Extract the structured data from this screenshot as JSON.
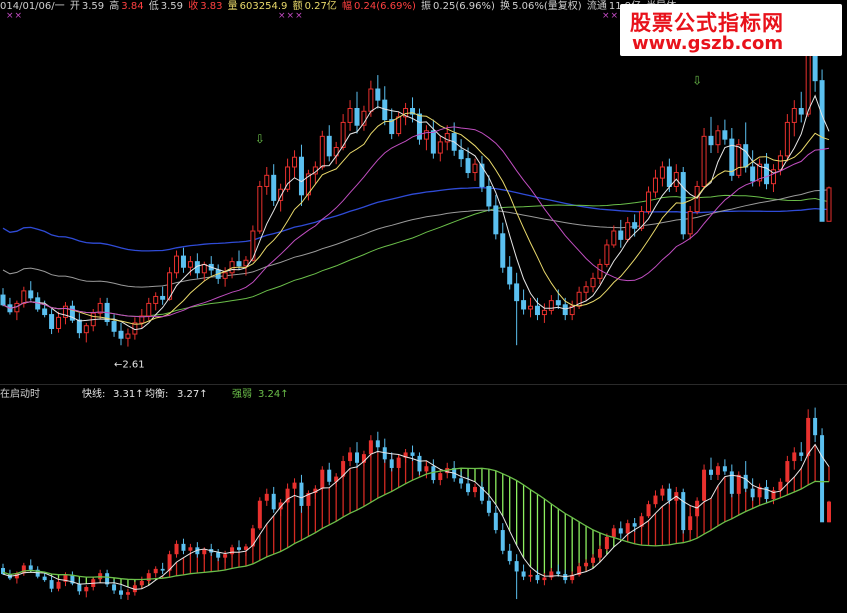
{
  "header": {
    "date": "014/01/06/一",
    "open_label": "开",
    "open": "3.59",
    "high_label": "高",
    "high": "3.84",
    "low_label": "低",
    "low": "3.59",
    "close_label": "收",
    "close": "3.83",
    "volume_label": "量",
    "volume": "603254.9",
    "amount_label": "额",
    "amount": "0.27亿",
    "change_label": "幅",
    "change": "0.24(6.69%)",
    "swing_label": "振",
    "swing": "0.25(6.96%)",
    "turnover_label": "换",
    "turnover": "5.06%(量复权)",
    "float_label": "流通",
    "float": "11.9亿",
    "period": "半导体",
    "marks": [
      "××",
      "×××",
      "××"
    ]
  },
  "watermark": {
    "line1": "股票公式指标网",
    "line2": "www.gszb.com"
  },
  "indicator": {
    "title": "在启动时",
    "fast_label": "快线:",
    "fast": "3.31↑",
    "balance_label": "均衡:",
    "balance": "3.27↑",
    "strength_label": "强弱",
    "strength": "3.24↑"
  },
  "colors": {
    "up": "#e8312e",
    "down": "#5bc0f0",
    "ma_white": "#e6e6e6",
    "ma_yellow": "#e9d96b",
    "ma_purple": "#c04ec0",
    "ma_green": "#6bbf4a",
    "ma_blue": "#2f4bd6",
    "ma_gray": "#9a9a9a",
    "osc_red": "#d32a22",
    "osc_green": "#8df060"
  },
  "chart_data": [
    {
      "type": "candlestick",
      "low_marker": "←2.61",
      "signal_marks": [
        "⇩",
        "⇩"
      ],
      "candles": [
        [
          3.06,
          3.11,
          2.98,
          2.99
        ],
        [
          2.99,
          3.04,
          2.92,
          2.94
        ],
        [
          2.94,
          3.02,
          2.88,
          3.0
        ],
        [
          3.0,
          3.12,
          2.97,
          3.09
        ],
        [
          3.09,
          3.16,
          3.02,
          3.04
        ],
        [
          3.04,
          3.08,
          2.94,
          2.96
        ],
        [
          2.96,
          3.02,
          2.9,
          2.92
        ],
        [
          2.92,
          2.96,
          2.78,
          2.82
        ],
        [
          2.82,
          2.94,
          2.79,
          2.9
        ],
        [
          2.9,
          3.01,
          2.85,
          2.98
        ],
        [
          2.98,
          3.02,
          2.86,
          2.88
        ],
        [
          2.88,
          2.93,
          2.75,
          2.79
        ],
        [
          2.79,
          2.86,
          2.72,
          2.84
        ],
        [
          2.84,
          2.96,
          2.8,
          2.93
        ],
        [
          2.93,
          3.04,
          2.89,
          3.0
        ],
        [
          3.0,
          3.04,
          2.84,
          2.87
        ],
        [
          2.87,
          2.92,
          2.76,
          2.8
        ],
        [
          2.8,
          2.86,
          2.7,
          2.75
        ],
        [
          2.75,
          2.82,
          2.69,
          2.78
        ],
        [
          2.78,
          2.9,
          2.74,
          2.86
        ],
        [
          2.86,
          2.96,
          2.82,
          2.91
        ],
        [
          2.91,
          3.04,
          2.88,
          3.0
        ],
        [
          3.0,
          3.08,
          2.95,
          3.05
        ],
        [
          3.05,
          3.12,
          2.99,
          3.03
        ],
        [
          3.03,
          3.26,
          3.02,
          3.22
        ],
        [
          3.22,
          3.38,
          3.18,
          3.34
        ],
        [
          3.34,
          3.4,
          3.22,
          3.26
        ],
        [
          3.26,
          3.34,
          3.2,
          3.3
        ],
        [
          3.3,
          3.36,
          3.18,
          3.22
        ],
        [
          3.22,
          3.3,
          3.16,
          3.28
        ],
        [
          3.28,
          3.34,
          3.2,
          3.24
        ],
        [
          3.24,
          3.28,
          3.14,
          3.18
        ],
        [
          3.18,
          3.26,
          3.12,
          3.22
        ],
        [
          3.22,
          3.33,
          3.18,
          3.3
        ],
        [
          3.3,
          3.38,
          3.24,
          3.27
        ],
        [
          3.27,
          3.34,
          3.2,
          3.31
        ],
        [
          3.31,
          3.56,
          3.3,
          3.52
        ],
        [
          3.52,
          3.88,
          3.5,
          3.84
        ],
        [
          3.84,
          3.98,
          3.78,
          3.92
        ],
        [
          3.92,
          4.0,
          3.7,
          3.74
        ],
        [
          3.74,
          3.86,
          3.66,
          3.82
        ],
        [
          3.82,
          4.04,
          3.8,
          3.98
        ],
        [
          3.98,
          4.1,
          3.9,
          4.05
        ],
        [
          4.05,
          4.14,
          3.7,
          3.78
        ],
        [
          3.78,
          3.96,
          3.74,
          3.93
        ],
        [
          3.93,
          4.02,
          3.86,
          3.98
        ],
        [
          3.98,
          4.24,
          3.96,
          4.2
        ],
        [
          4.2,
          4.28,
          4.02,
          4.06
        ],
        [
          4.06,
          4.16,
          4.0,
          4.12
        ],
        [
          4.12,
          4.36,
          4.1,
          4.3
        ],
        [
          4.3,
          4.46,
          4.24,
          4.4
        ],
        [
          4.4,
          4.52,
          4.22,
          4.28
        ],
        [
          4.28,
          4.42,
          4.24,
          4.38
        ],
        [
          4.38,
          4.6,
          4.34,
          4.54
        ],
        [
          4.54,
          4.64,
          4.4,
          4.46
        ],
        [
          4.46,
          4.56,
          4.28,
          4.32
        ],
        [
          4.32,
          4.4,
          4.18,
          4.22
        ],
        [
          4.22,
          4.38,
          4.2,
          4.34
        ],
        [
          4.34,
          4.44,
          4.28,
          4.4
        ],
        [
          4.4,
          4.48,
          4.3,
          4.36
        ],
        [
          4.36,
          4.4,
          4.14,
          4.18
        ],
        [
          4.18,
          4.28,
          4.1,
          4.24
        ],
        [
          4.24,
          4.32,
          4.04,
          4.08
        ],
        [
          4.08,
          4.2,
          4.02,
          4.16
        ],
        [
          4.16,
          4.28,
          4.1,
          4.22
        ],
        [
          4.22,
          4.3,
          4.06,
          4.1
        ],
        [
          4.1,
          4.18,
          3.98,
          4.04
        ],
        [
          4.04,
          4.12,
          3.9,
          3.94
        ],
        [
          3.94,
          4.04,
          3.88,
          4.0
        ],
        [
          4.0,
          4.06,
          3.8,
          3.84
        ],
        [
          3.84,
          3.92,
          3.66,
          3.7
        ],
        [
          3.7,
          3.78,
          3.46,
          3.5
        ],
        [
          3.5,
          3.58,
          3.22,
          3.26
        ],
        [
          3.26,
          3.34,
          3.1,
          3.14
        ],
        [
          3.14,
          3.22,
          2.7,
          3.02
        ],
        [
          3.02,
          3.1,
          2.92,
          2.96
        ],
        [
          2.96,
          3.04,
          2.9,
          2.98
        ],
        [
          2.98,
          3.04,
          2.88,
          2.92
        ],
        [
          2.92,
          3.0,
          2.86,
          2.95
        ],
        [
          2.95,
          3.06,
          2.92,
          3.02
        ],
        [
          3.02,
          3.1,
          2.96,
          2.99
        ],
        [
          2.99,
          3.04,
          2.88,
          2.92
        ],
        [
          2.92,
          3.02,
          2.88,
          2.98
        ],
        [
          2.98,
          3.12,
          2.96,
          3.08
        ],
        [
          3.08,
          3.16,
          3.02,
          3.12
        ],
        [
          3.12,
          3.22,
          3.08,
          3.18
        ],
        [
          3.18,
          3.32,
          3.14,
          3.28
        ],
        [
          3.28,
          3.46,
          3.26,
          3.42
        ],
        [
          3.42,
          3.56,
          3.4,
          3.52
        ],
        [
          3.52,
          3.6,
          3.4,
          3.46
        ],
        [
          3.46,
          3.62,
          3.44,
          3.58
        ],
        [
          3.58,
          3.64,
          3.48,
          3.54
        ],
        [
          3.54,
          3.7,
          3.52,
          3.66
        ],
        [
          3.66,
          3.84,
          3.64,
          3.8
        ],
        [
          3.8,
          3.96,
          3.76,
          3.9
        ],
        [
          3.9,
          4.02,
          3.84,
          3.98
        ],
        [
          3.98,
          4.04,
          3.8,
          3.84
        ],
        [
          3.84,
          4.0,
          3.8,
          3.94
        ],
        [
          3.94,
          3.98,
          3.46,
          3.5
        ],
        [
          3.5,
          3.7,
          3.46,
          3.66
        ],
        [
          3.66,
          3.88,
          3.64,
          3.84
        ],
        [
          3.84,
          4.26,
          3.82,
          4.2
        ],
        [
          4.2,
          4.34,
          4.08,
          4.14
        ],
        [
          4.14,
          4.28,
          4.08,
          4.24
        ],
        [
          4.24,
          4.32,
          4.14,
          4.18
        ],
        [
          4.18,
          4.26,
          3.88,
          3.92
        ],
        [
          3.92,
          4.18,
          3.9,
          4.14
        ],
        [
          4.14,
          4.3,
          3.94,
          3.98
        ],
        [
          3.98,
          4.1,
          3.84,
          3.88
        ],
        [
          3.88,
          4.04,
          3.84,
          4.0
        ],
        [
          4.0,
          4.08,
          3.82,
          3.86
        ],
        [
          3.86,
          4.0,
          3.8,
          3.96
        ],
        [
          3.96,
          4.1,
          3.92,
          4.06
        ],
        [
          4.06,
          4.36,
          4.02,
          4.3
        ],
        [
          4.3,
          4.46,
          4.2,
          4.4
        ],
        [
          4.4,
          4.52,
          4.3,
          4.36
        ],
        [
          4.36,
          4.9,
          4.34,
          4.8
        ],
        [
          4.8,
          4.92,
          4.52,
          4.6
        ],
        [
          4.6,
          4.68,
          4.54,
          3.59
        ],
        [
          3.59,
          3.84,
          3.59,
          3.83
        ]
      ]
    }
  ]
}
